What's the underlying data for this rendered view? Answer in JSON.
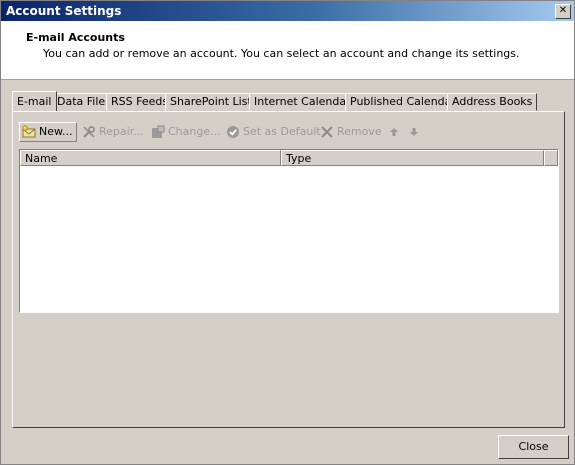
{
  "window": {
    "title": "Account Settings",
    "close_glyph": "✕"
  },
  "header": {
    "title": "E-mail Accounts",
    "description": "You can add or remove an account. You can select an account and change its settings."
  },
  "tabs": [
    {
      "label": "E-mail",
      "active": true
    },
    {
      "label": "Data Files"
    },
    {
      "label": "RSS Feeds"
    },
    {
      "label": "SharePoint Lists"
    },
    {
      "label": "Internet Calendars"
    },
    {
      "label": "Published Calendars"
    },
    {
      "label": "Address Books"
    }
  ],
  "toolbar": {
    "new_label": "New...",
    "repair_label": "Repair...",
    "change_label": "Change...",
    "default_label": "Set as Default",
    "remove_label": "Remove"
  },
  "list": {
    "col_name": "Name",
    "col_type": "Type"
  },
  "footer": {
    "close_label": "Close"
  },
  "colors": {
    "title_start": "#0a246a",
    "face": "#d4d0c8",
    "disabled_text": "#9a9a9a"
  }
}
